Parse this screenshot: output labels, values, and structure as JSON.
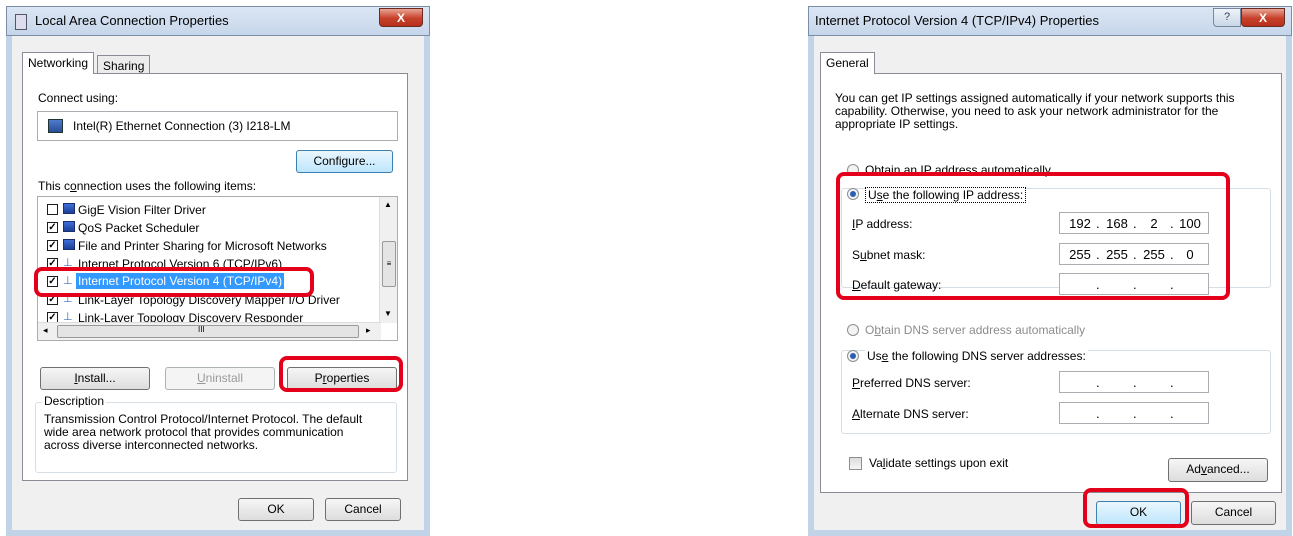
{
  "left": {
    "title": "Local Area Connection Properties",
    "close_label": "X",
    "tabs": [
      "Networking",
      "Sharing"
    ],
    "connect_using_label": "Connect using:",
    "adapter": "Intel(R) Ethernet Connection (3) I218-LM",
    "configure_label": "Configure...",
    "items_label": "This connection uses the following items:",
    "items": [
      {
        "checked": false,
        "text": "GigE Vision Filter Driver"
      },
      {
        "checked": true,
        "text": "QoS Packet Scheduler"
      },
      {
        "checked": true,
        "text": "File and Printer Sharing for Microsoft Networks"
      },
      {
        "checked": true,
        "text": "Internet Protocol Version 6 (TCP/IPv6)"
      },
      {
        "checked": true,
        "text": "Internet Protocol Version 4 (TCP/IPv4)"
      },
      {
        "checked": true,
        "text": "Link-Layer Topology Discovery Mapper I/O Driver"
      },
      {
        "checked": true,
        "text": "Link-Layer Topology Discovery Responder"
      }
    ],
    "scroll_mid": "III",
    "install_label": "Install...",
    "uninstall_label": "Uninstall",
    "properties_label": "Properties",
    "description_label": "Description",
    "description_text": "Transmission Control Protocol/Internet Protocol. The default wide area network protocol that provides communication across diverse interconnected networks.",
    "ok_label": "OK",
    "cancel_label": "Cancel"
  },
  "right": {
    "title": "Internet Protocol Version 4 (TCP/IPv4) Properties",
    "help_label": "?",
    "close_label": "X",
    "tab": "General",
    "intro": "You can get IP settings assigned automatically if your network supports this capability. Otherwise, you need to ask your network administrator for the appropriate IP settings.",
    "obtain_ip_label": "Obtain an IP address automatically",
    "use_ip_label": "Use the following IP address:",
    "ip_label": "IP address:",
    "ip_value": [
      "192",
      "168",
      "2",
      "100"
    ],
    "subnet_label": "Subnet mask:",
    "subnet_value": [
      "255",
      "255",
      "255",
      "0"
    ],
    "gateway_label": "Default gateway:",
    "gateway_value": [
      "",
      "",
      "",
      ""
    ],
    "obtain_dns_label": "Obtain DNS server address automatically",
    "use_dns_label": "Use the following DNS server addresses:",
    "preferred_dns_label": "Preferred DNS server:",
    "alternate_dns_label": "Alternate DNS server:",
    "validate_label": "Validate settings upon exit",
    "advanced_label": "Advanced...",
    "ok_label": "OK",
    "cancel_label": "Cancel",
    "selected_ip_option": "use_ip",
    "selected_dns_option": "use_dns"
  },
  "colors": {
    "highlight": "#e4001b",
    "selection": "#3399ff"
  }
}
